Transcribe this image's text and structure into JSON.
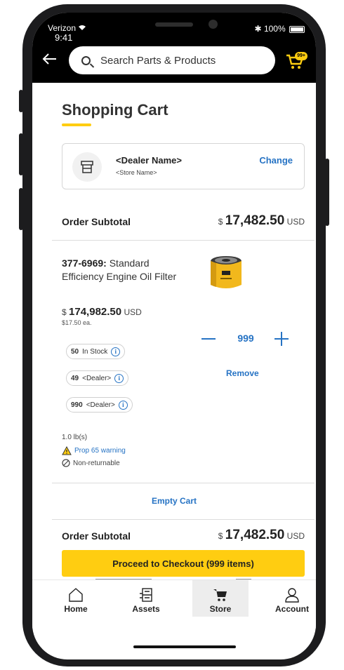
{
  "status_bar": {
    "carrier": "Verizon",
    "time": "9:41",
    "battery_pct": "100%"
  },
  "header": {
    "search_placeholder": "Search Parts & Products",
    "cart_badge": "99+"
  },
  "page": {
    "title": "Shopping Cart"
  },
  "dealer": {
    "name": "<Dealer Name>",
    "store": "<Store Name>",
    "change_label": "Change"
  },
  "subtotal_top": {
    "label": "Order Subtotal",
    "currency_symbol": "$",
    "amount": "17,482.50",
    "currency": "USD"
  },
  "item": {
    "part_number": "377-6969:",
    "name": "Standard Efficiency Engine Oil Filter",
    "price_symbol": "$",
    "price": "174,982.50",
    "price_currency": "USD",
    "each_price": "$17.50 ea.",
    "quantity": "999",
    "remove_label": "Remove",
    "stock": [
      {
        "qty": "50",
        "label": "In Stock"
      },
      {
        "qty": "49",
        "label": "<Dealer>"
      },
      {
        "qty": "990",
        "label": "<Dealer>"
      }
    ],
    "weight": "1.0 lb(s)",
    "prop65": "Prop 65 warning",
    "non_returnable": "Non-returnable"
  },
  "empty_cart_label": "Empty Cart",
  "subtotal_bottom": {
    "label": "Order Subtotal",
    "currency_symbol": "$",
    "amount": "17,482.50",
    "currency": "USD"
  },
  "checkout_label": "Proceed to Checkout (999 items)",
  "bottom_nav": {
    "home": "Home",
    "assets": "Assets",
    "store": "Store",
    "account": "Account"
  },
  "colors": {
    "accent_yellow": "#ffcd11",
    "link_blue": "#2673c4",
    "header_bg": "#000000"
  }
}
